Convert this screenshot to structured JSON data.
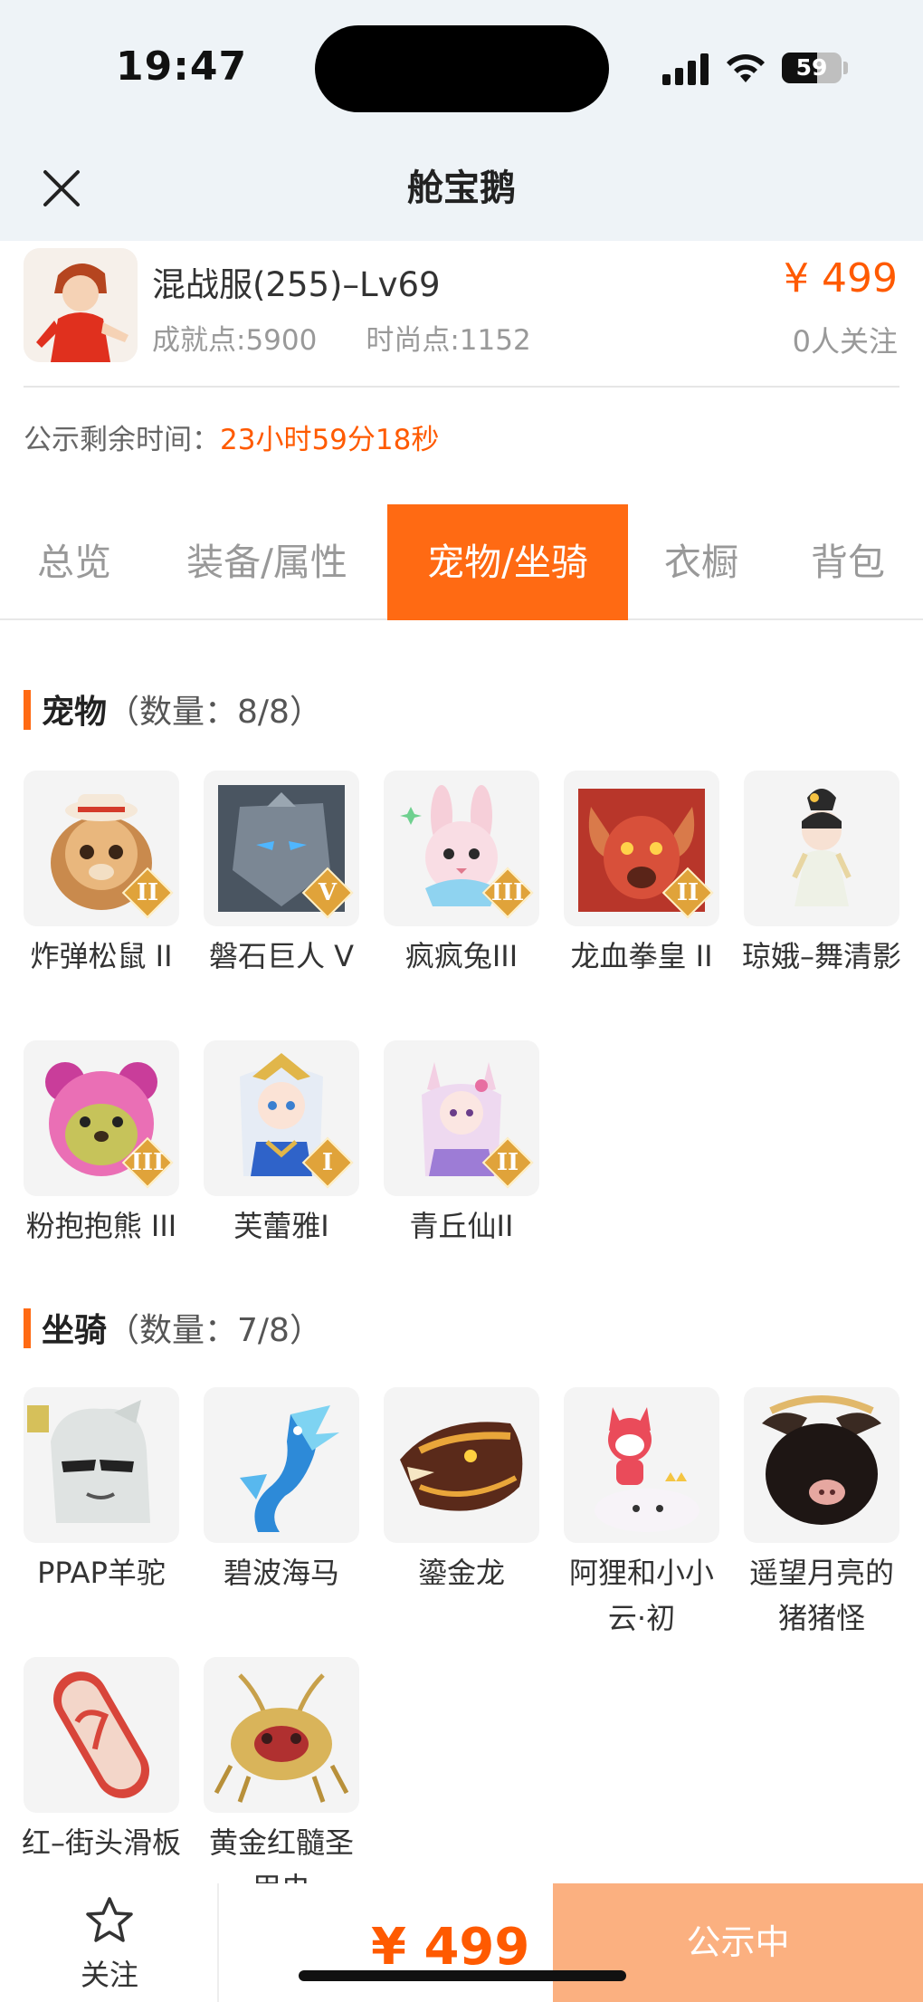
{
  "status": {
    "time": "19:47",
    "battery": "59",
    "battery_level": 0.59
  },
  "nav": {
    "title": "舱宝鹅"
  },
  "header": {
    "server_title": "混战服(255)–Lv69",
    "achievement_points": "成就点:5900",
    "fashion_points": "时尚点:1152",
    "price": "¥ 499",
    "follow_count": "0人关注"
  },
  "notice": {
    "label": "公示剩余时间：",
    "remaining": "23小时59分18秒"
  },
  "tabs": [
    {
      "label": "总览"
    },
    {
      "label": "装备/属性"
    },
    {
      "label": "宠物/坐骑",
      "active": true
    },
    {
      "label": "衣橱"
    },
    {
      "label": "背包"
    }
  ],
  "pets": {
    "title": "宠物",
    "count": "（数量：8/8）",
    "items": [
      {
        "label": "炸弹松鼠 II",
        "badge": "II"
      },
      {
        "label": "磐石巨人 V",
        "badge": "V"
      },
      {
        "label": "疯疯兔III",
        "badge": "III"
      },
      {
        "label": "龙血拳皇 II",
        "badge": "II"
      },
      {
        "label": "琼娥–舞清影",
        "badge": ""
      },
      {
        "label": "粉抱抱熊 III",
        "badge": "III"
      },
      {
        "label": "芙蕾雅I",
        "badge": "I"
      },
      {
        "label": "青丘仙II",
        "badge": "II"
      }
    ]
  },
  "mounts": {
    "title": "坐骑",
    "count": "（数量：7/8）",
    "items": [
      {
        "label": "PPAP羊驼"
      },
      {
        "label": "碧波海马"
      },
      {
        "label": "鎏金龙"
      },
      {
        "label": "阿狸和小小云·初"
      },
      {
        "label": "遥望月亮的猪猪怪"
      },
      {
        "label": "红–街头滑板"
      },
      {
        "label": "黄金红髓圣甲虫"
      }
    ]
  },
  "bottom": {
    "follow_label": "关注",
    "price": "¥ 499",
    "status_label": "公示中"
  },
  "colors": {
    "accent": "#ff6a13",
    "price": "#ff5a00",
    "status_button": "#fbb080"
  }
}
